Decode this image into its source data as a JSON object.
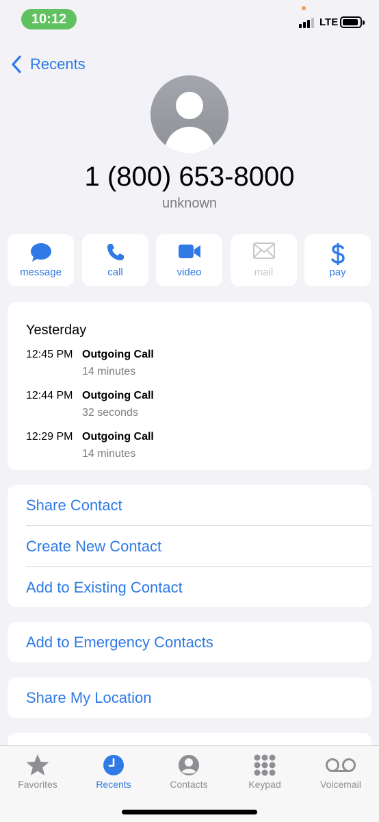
{
  "status_bar": {
    "time": "10:12",
    "network": "LTE"
  },
  "nav": {
    "back_label": "Recents"
  },
  "contact": {
    "number": "1 (800) 653-8000",
    "label": "unknown"
  },
  "actions": [
    {
      "label": "message",
      "icon": "message-icon",
      "enabled": true
    },
    {
      "label": "call",
      "icon": "phone-icon",
      "enabled": true
    },
    {
      "label": "video",
      "icon": "video-camera-icon",
      "enabled": true
    },
    {
      "label": "mail",
      "icon": "envelope-icon",
      "enabled": false
    },
    {
      "label": "pay",
      "icon": "dollar-icon",
      "enabled": true
    }
  ],
  "call_history": {
    "date": "Yesterday",
    "calls": [
      {
        "time": "12:45 PM",
        "type": "Outgoing Call",
        "duration": "14 minutes"
      },
      {
        "time": "12:44 PM",
        "type": "Outgoing Call",
        "duration": "32 seconds"
      },
      {
        "time": "12:29 PM",
        "type": "Outgoing Call",
        "duration": "14 minutes"
      }
    ]
  },
  "contact_options": [
    "Share Contact",
    "Create New Contact",
    "Add to Existing Contact"
  ],
  "emergency": "Add to Emergency Contacts",
  "location": "Share My Location",
  "tabs": [
    {
      "label": "Favorites",
      "icon": "star-icon",
      "active": false
    },
    {
      "label": "Recents",
      "icon": "clock-icon",
      "active": true
    },
    {
      "label": "Contacts",
      "icon": "person-circle-icon",
      "active": false
    },
    {
      "label": "Keypad",
      "icon": "keypad-icon",
      "active": false
    },
    {
      "label": "Voicemail",
      "icon": "voicemail-icon",
      "active": false
    }
  ],
  "colors": {
    "accent": "#2f7ae5",
    "background": "#f2f2f7",
    "time_pill": "#5fc15f",
    "inactive": "#8e8e93"
  }
}
